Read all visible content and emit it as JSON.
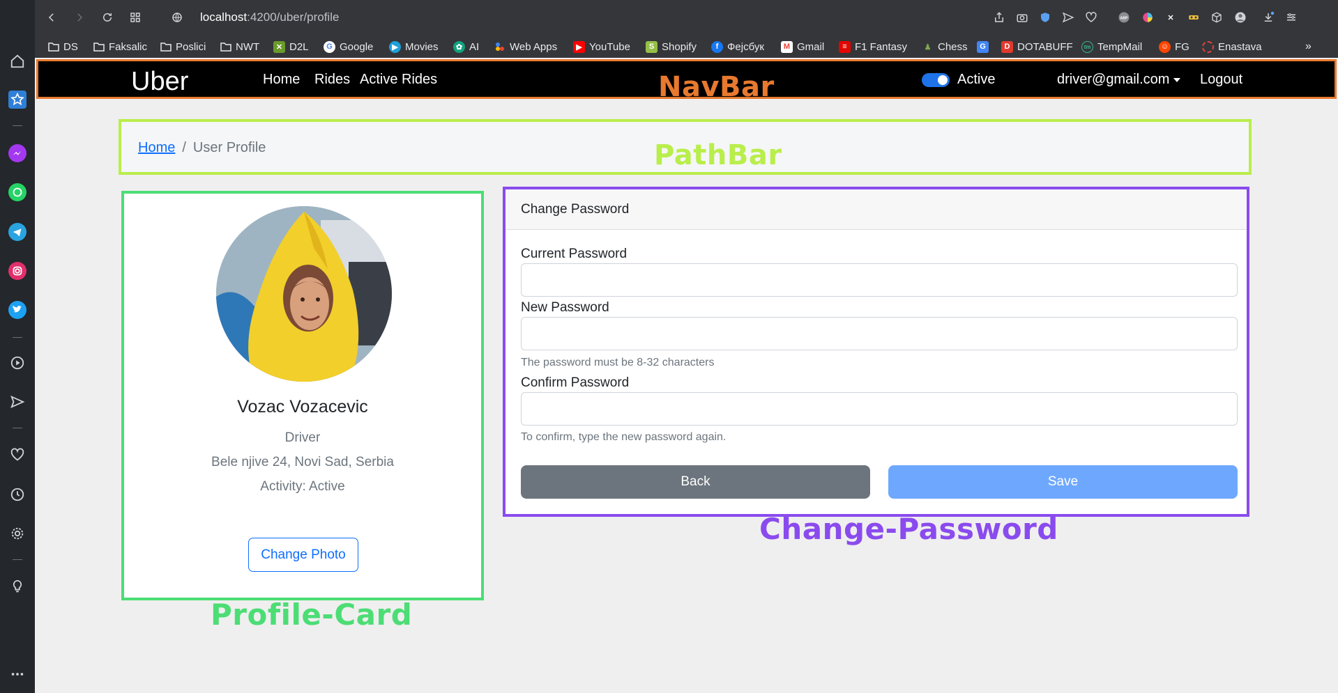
{
  "browser": {
    "url_host": "localhost",
    "url_path": ":4200/uber/profile",
    "bookmarks": [
      {
        "label": "DS",
        "icon": "folder-icon"
      },
      {
        "label": "Faksalic",
        "icon": "folder-icon"
      },
      {
        "label": "Poslici",
        "icon": "folder-icon"
      },
      {
        "label": "NWT",
        "icon": "folder-icon"
      },
      {
        "label": "D2L",
        "icon": "d2l-icon"
      },
      {
        "label": "Google",
        "icon": "google-icon"
      },
      {
        "label": "Movies",
        "icon": "movies-icon"
      },
      {
        "label": "AI",
        "icon": "ai-icon"
      },
      {
        "label": "Web Apps",
        "icon": "web-apps-icon"
      },
      {
        "label": "YouTube",
        "icon": "youtube-icon"
      },
      {
        "label": "Shopify",
        "icon": "shopify-icon"
      },
      {
        "label": "Фејсбук",
        "icon": "facebook-icon"
      },
      {
        "label": "Gmail",
        "icon": "gmail-icon"
      },
      {
        "label": "F1 Fantasy",
        "icon": "f1-icon"
      },
      {
        "label": "Chess",
        "icon": "chess-icon"
      },
      {
        "label": "DOTABUFF",
        "icon": "dotabuff-icon"
      },
      {
        "label": "TempMail",
        "icon": "tempmail-icon"
      },
      {
        "label": "FG",
        "icon": "reddit-icon"
      },
      {
        "label": "Enastava",
        "icon": "enastava-icon"
      }
    ]
  },
  "navbar": {
    "brand": "Uber",
    "links": [
      "Home",
      "Rides",
      "Active Rides"
    ],
    "active_label": "Active",
    "user_email": "driver@gmail.com",
    "logout": "Logout",
    "annotation": "NavBar"
  },
  "breadcrumb": {
    "home": "Home",
    "separator": "/",
    "current": "User Profile",
    "annotation": "PathBar"
  },
  "profile": {
    "name": "Vozac Vozacevic",
    "role": "Driver",
    "address": "Bele njive 24, Novi Sad, Serbia",
    "activity": "Activity: Active",
    "change_photo": "Change Photo",
    "annotation": "Profile-Card"
  },
  "password": {
    "title": "Change Password",
    "current_label": "Current Password",
    "new_label": "New Password",
    "new_help": "The password must be 8-32 characters",
    "confirm_label": "Confirm Password",
    "confirm_help": "To confirm, type the new password again.",
    "back": "Back",
    "save": "Save",
    "annotation": "Change-Password"
  },
  "colors": {
    "navbar_border": "#e8792f",
    "pathbar_border": "#b9ee4b",
    "profile_border": "#4cdd75",
    "password_border": "#8a4bee",
    "primary": "#0d6efd"
  }
}
